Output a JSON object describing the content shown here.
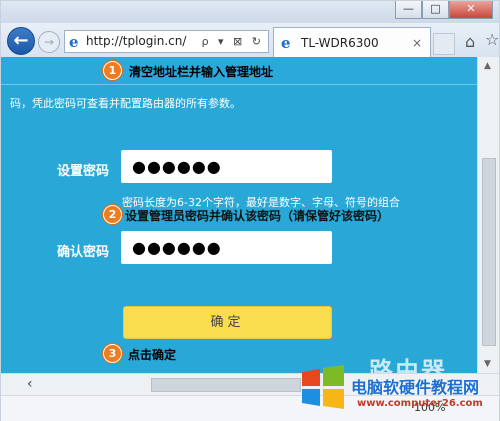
{
  "browser": {
    "address": "http://tplogin.cn/",
    "address_tools": "ρ ▾ ⊠ ↻",
    "tab_title": "TL-WDR6300",
    "tab_close": "×",
    "back_icon": "←",
    "forward_icon": "→",
    "zoom": "100%",
    "window_buttons": {
      "minimize": "—",
      "maximize": "□",
      "close": "✕"
    }
  },
  "page": {
    "description": "码，凭此密码可查看并配置路由器的所有参数。",
    "set_password_label": "设置密码",
    "set_password_value": "●●●●●●",
    "hint": "密码长度为6-32个字符，最好是数字、字母、符号的组合",
    "confirm_password_label": "确认密码",
    "confirm_password_value": "●●●●●●",
    "confirm_button": "确定"
  },
  "annotations": [
    {
      "number": "1",
      "text": "清空地址栏并输入管理地址"
    },
    {
      "number": "2",
      "text": "设置管理员密码并确认该密码（请保管好该密码）"
    },
    {
      "number": "3",
      "text": "点击确定"
    }
  ],
  "watermark": {
    "big": "路由器",
    "title": "电脑软硬件教程网",
    "url": "www.computer26.com"
  },
  "colors": {
    "page_bg": "#29a8d8",
    "button_yellow": "#f9dd4f",
    "badge_orange": "#ee7d1f"
  }
}
